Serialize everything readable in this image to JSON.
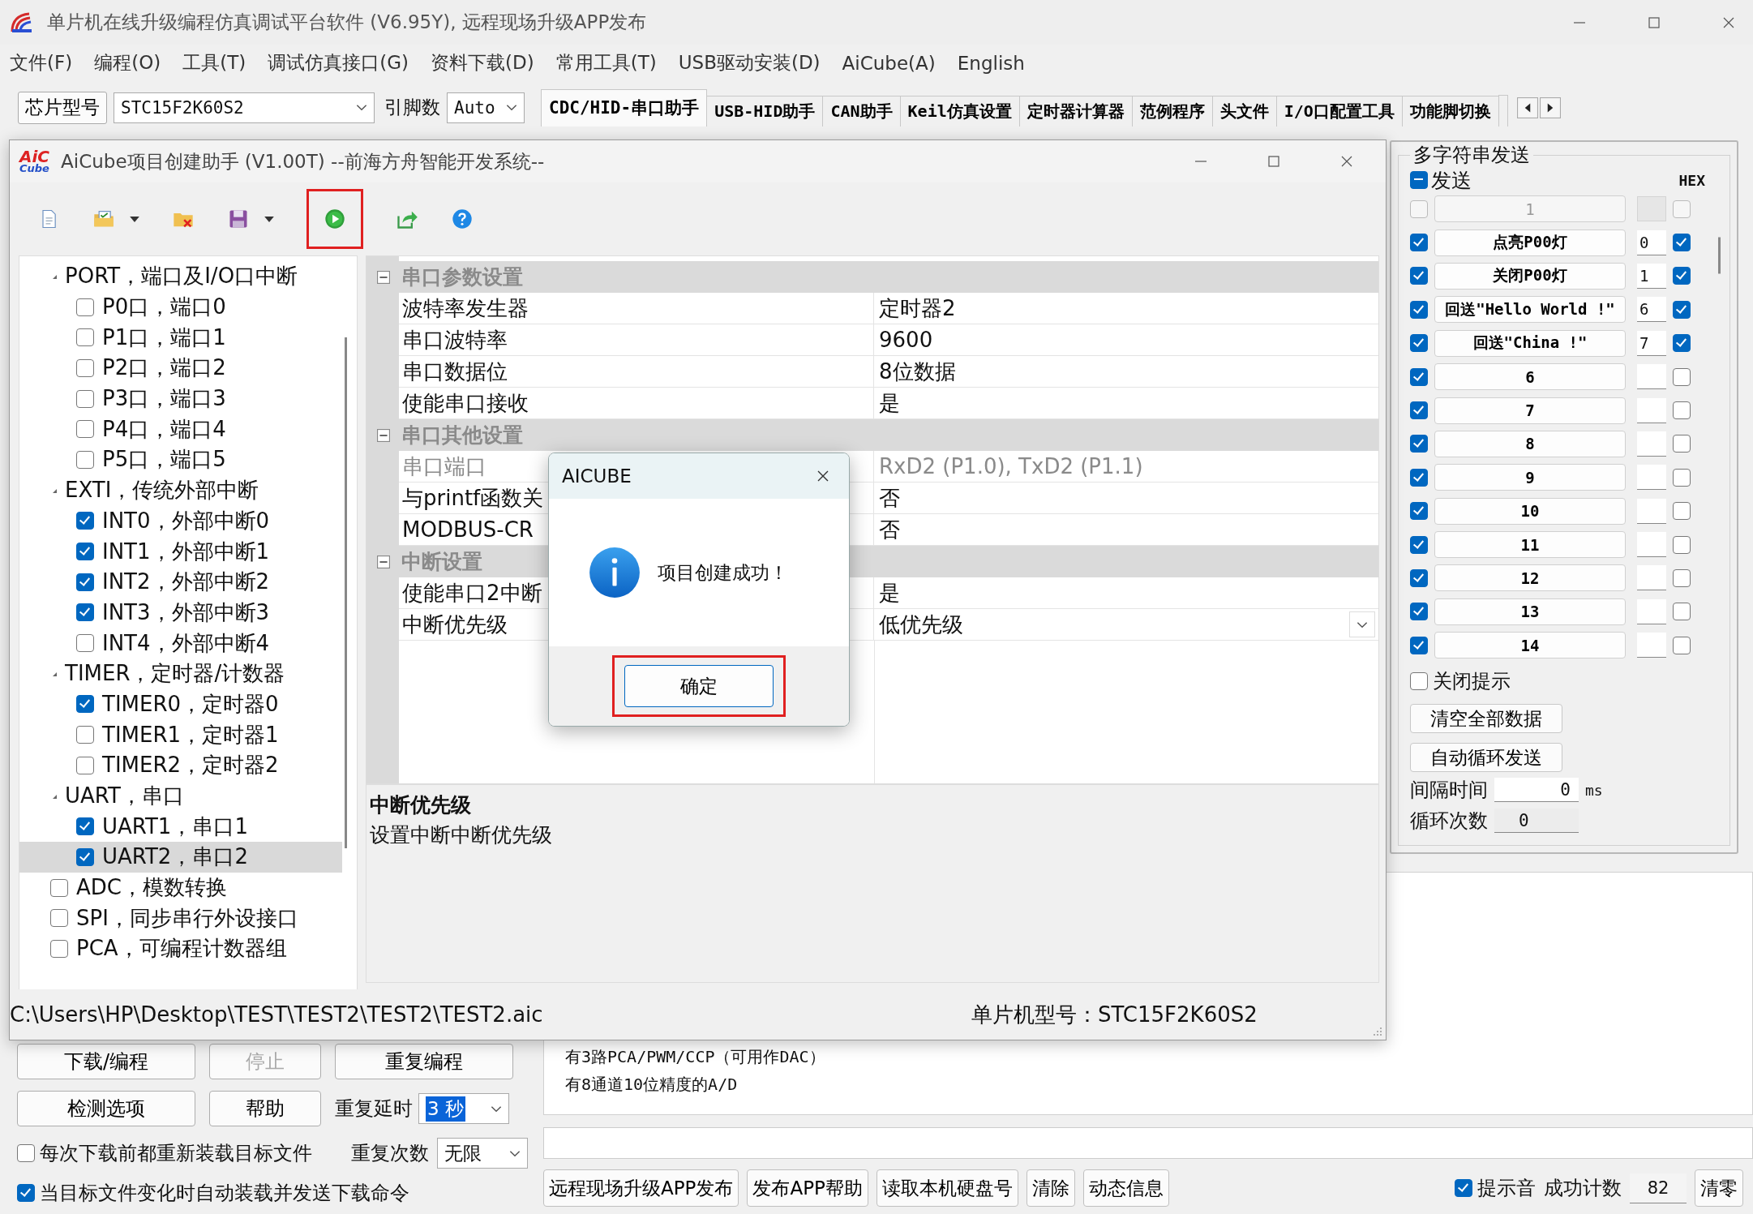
{
  "window": {
    "title": "单片机在线升级编程仿真调试平台软件 (V6.95Y), 远程现场升级APP发布"
  },
  "menu": [
    "文件(F)",
    "编程(O)",
    "工具(T)",
    "调试仿真接口(G)",
    "资料下载(D)",
    "常用工具(T)",
    "USB驱动安装(D)",
    "AiCube(A)",
    "English"
  ],
  "toolbar": {
    "chip_label": "芯片型号",
    "chip_value": "STC15F2K60S2",
    "pins_label": "引脚数",
    "pins_value": "Auto"
  },
  "tabs": [
    {
      "label": "CDC/HID-串口助手",
      "selected": true
    },
    {
      "label": "USB-HID助手",
      "selected": false
    },
    {
      "label": "CAN助手",
      "selected": false
    },
    {
      "label": "Keil仿真设置",
      "selected": false
    },
    {
      "label": "定时器计算器",
      "selected": false
    },
    {
      "label": "范例程序",
      "selected": false
    },
    {
      "label": "头文件",
      "selected": false
    },
    {
      "label": "I/O口配置工具",
      "selected": false
    },
    {
      "label": "功能脚切换",
      "selected": false
    }
  ],
  "aicube": {
    "logo": [
      "AiC",
      "Cube"
    ],
    "title": "AiCube项目创建助手 (V1.00T) --前海方舟智能开发系统--",
    "tools": [
      {
        "kind": "new",
        "highlighted": false
      },
      {
        "kind": "open",
        "dropdown": true,
        "highlighted": false
      },
      {
        "kind": "close",
        "highlighted": false
      },
      {
        "kind": "save",
        "dropdown": true,
        "highlighted": false
      },
      {
        "kind": "run",
        "highlighted": true
      },
      {
        "kind": "export",
        "highlighted": false
      },
      {
        "kind": "help",
        "highlighted": false
      }
    ],
    "tree": [
      {
        "kind": "group",
        "label": "PORT，端口及I/O口中断",
        "expanded": true,
        "selected": false,
        "children": [
          {
            "kind": "item",
            "label": "P0口，端口0",
            "checked": false,
            "selected": false
          },
          {
            "kind": "item",
            "label": "P1口，端口1",
            "checked": false,
            "selected": false
          },
          {
            "kind": "item",
            "label": "P2口，端口2",
            "checked": false,
            "selected": false
          },
          {
            "kind": "item",
            "label": "P3口，端口3",
            "checked": false,
            "selected": false
          },
          {
            "kind": "item",
            "label": "P4口，端口4",
            "checked": false,
            "selected": false
          },
          {
            "kind": "item",
            "label": "P5口，端口5",
            "checked": false,
            "selected": false
          }
        ]
      },
      {
        "kind": "group",
        "label": "EXTI，传统外部中断",
        "expanded": true,
        "selected": false,
        "children": [
          {
            "kind": "item",
            "label": "INT0，外部中断0",
            "checked": true,
            "selected": false
          },
          {
            "kind": "item",
            "label": "INT1，外部中断1",
            "checked": true,
            "selected": false
          },
          {
            "kind": "item",
            "label": "INT2，外部中断2",
            "checked": true,
            "selected": false
          },
          {
            "kind": "item",
            "label": "INT3，外部中断3",
            "checked": true,
            "selected": false
          },
          {
            "kind": "item",
            "label": "INT4，外部中断4",
            "checked": false,
            "selected": false
          }
        ]
      },
      {
        "kind": "group",
        "label": "TIMER，定时器/计数器",
        "expanded": true,
        "selected": false,
        "children": [
          {
            "kind": "item",
            "label": "TIMER0，定时器0",
            "checked": true,
            "selected": false
          },
          {
            "kind": "item",
            "label": "TIMER1，定时器1",
            "checked": false,
            "selected": false
          },
          {
            "kind": "item",
            "label": "TIMER2，定时器2",
            "checked": false,
            "selected": false
          }
        ]
      },
      {
        "kind": "group",
        "label": "UART，串口",
        "expanded": true,
        "selected": false,
        "children": [
          {
            "kind": "item",
            "label": "UART1，串口1",
            "checked": true,
            "selected": false
          },
          {
            "kind": "item",
            "label": "UART2，串口2",
            "checked": true,
            "selected": true
          }
        ]
      },
      {
        "kind": "item",
        "label": "ADC，模数转换",
        "checked": false,
        "selected": false
      },
      {
        "kind": "item",
        "label": "SPI，同步串行外设接口",
        "checked": false,
        "selected": false
      },
      {
        "kind": "item",
        "label": "PCA，可编程计数器组",
        "checked": false,
        "selected": false
      }
    ],
    "sections": [
      {
        "title": "串口参数设置",
        "expanded": true,
        "rows": [
          {
            "name": "波特率发生器",
            "value": "定时器2",
            "disabled": false
          },
          {
            "name": "串口波特率",
            "value": "9600",
            "disabled": false
          },
          {
            "name": "串口数据位",
            "value": "8位数据",
            "disabled": false
          },
          {
            "name": "使能串口接收",
            "value": "是",
            "disabled": false
          }
        ]
      },
      {
        "title": "串口其他设置",
        "expanded": true,
        "rows": [
          {
            "name": "串口端口",
            "value": "RxD2 (P1.0), TxD2 (P1.1)",
            "disabled": true
          },
          {
            "name": "与printf函数关",
            "value": "否",
            "disabled": false
          },
          {
            "name": "MODBUS-CR",
            "value": "否",
            "disabled": false
          }
        ]
      },
      {
        "title": "中断设置",
        "expanded": true,
        "rows": [
          {
            "name": "使能串口2中断",
            "value": "是",
            "disabled": false
          },
          {
            "name": "中断优先级",
            "value": "低优先级",
            "disabled": false,
            "dropdown": true
          }
        ]
      }
    ],
    "description": {
      "title": "中断优先级",
      "text": "设置中断中断优先级"
    },
    "status": {
      "path": "C:\\Users\\HP\\Desktop\\TEST\\TEST2\\TEST2\\TEST2.aic",
      "chip": "单片机型号：STC15F2K60S2"
    }
  },
  "dialog": {
    "title": "AICUBE",
    "message": "项目创建成功！",
    "button": "确定",
    "highlighted": true
  },
  "multi_send": {
    "title": "多字符串发送",
    "send_label": "发送",
    "send_partial": true,
    "hex_label": "HEX",
    "rows": [
      {
        "checked": false,
        "label": "1",
        "hex": false,
        "disabled": true
      },
      {
        "checked": true,
        "label": "点亮P00灯",
        "key": "0",
        "hex": true,
        "disabled": false
      },
      {
        "checked": true,
        "label": "关闭P00灯",
        "key": "1",
        "hex": true,
        "disabled": false
      },
      {
        "checked": true,
        "label": "回送\"Hello World !\"",
        "key": "6",
        "hex": true,
        "disabled": false
      },
      {
        "checked": true,
        "label": "回送\"China !\"",
        "key": "7",
        "hex": true,
        "disabled": false
      },
      {
        "checked": true,
        "label": "6",
        "hex": false,
        "disabled": false
      },
      {
        "checked": true,
        "label": "7",
        "hex": false,
        "disabled": false
      },
      {
        "checked": true,
        "label": "8",
        "hex": false,
        "disabled": false
      },
      {
        "checked": true,
        "label": "9",
        "hex": false,
        "disabled": false
      },
      {
        "checked": true,
        "label": "10",
        "hex": false,
        "disabled": false
      },
      {
        "checked": true,
        "label": "11",
        "hex": false,
        "disabled": false
      },
      {
        "checked": true,
        "label": "12",
        "hex": false,
        "disabled": false
      },
      {
        "checked": true,
        "label": "13",
        "hex": false,
        "disabled": false
      },
      {
        "checked": true,
        "label": "14",
        "hex": false,
        "disabled": false
      }
    ],
    "close_hint": {
      "label": "关闭提示",
      "checked": false
    },
    "buttons": [
      "清空全部数据",
      "自动循环发送"
    ],
    "interval": {
      "label": "间隔时间",
      "value": "0",
      "unit": "ms"
    },
    "loops": {
      "label": "循环次数",
      "value": "0"
    }
  },
  "program_buttons": [
    {
      "label": "下载/编程",
      "disabled": false
    },
    {
      "label": "停止",
      "disabled": true
    },
    {
      "label": "重复编程",
      "disabled": false
    }
  ],
  "tool_buttons": [
    {
      "label": "检测选项",
      "disabled": false
    },
    {
      "label": "帮助",
      "disabled": false
    }
  ],
  "repeat_delay": {
    "label": "重复延时",
    "value": "3 秒"
  },
  "repeat_count": {
    "label": "重复次数",
    "value": "无限"
  },
  "options": [
    {
      "label": "每次下载前都重新装载目标文件",
      "checked": false
    },
    {
      "label": "当目标文件变化时自动装载并发送下载命令",
      "checked": true
    }
  ],
  "output": {
    "lines": [
      "有3路PCA/PWM/CCP（可用作DAC）",
      "有8通道10位精度的A/D"
    ]
  },
  "action_buttons": [
    "远程现场升级APP发布",
    "发布APP帮助",
    "读取本机硬盘号",
    "清除",
    "动态信息"
  ],
  "beep": {
    "label": "提示音",
    "checked": true
  },
  "success": {
    "label": "成功计数",
    "value": "82",
    "reset": "清零"
  }
}
